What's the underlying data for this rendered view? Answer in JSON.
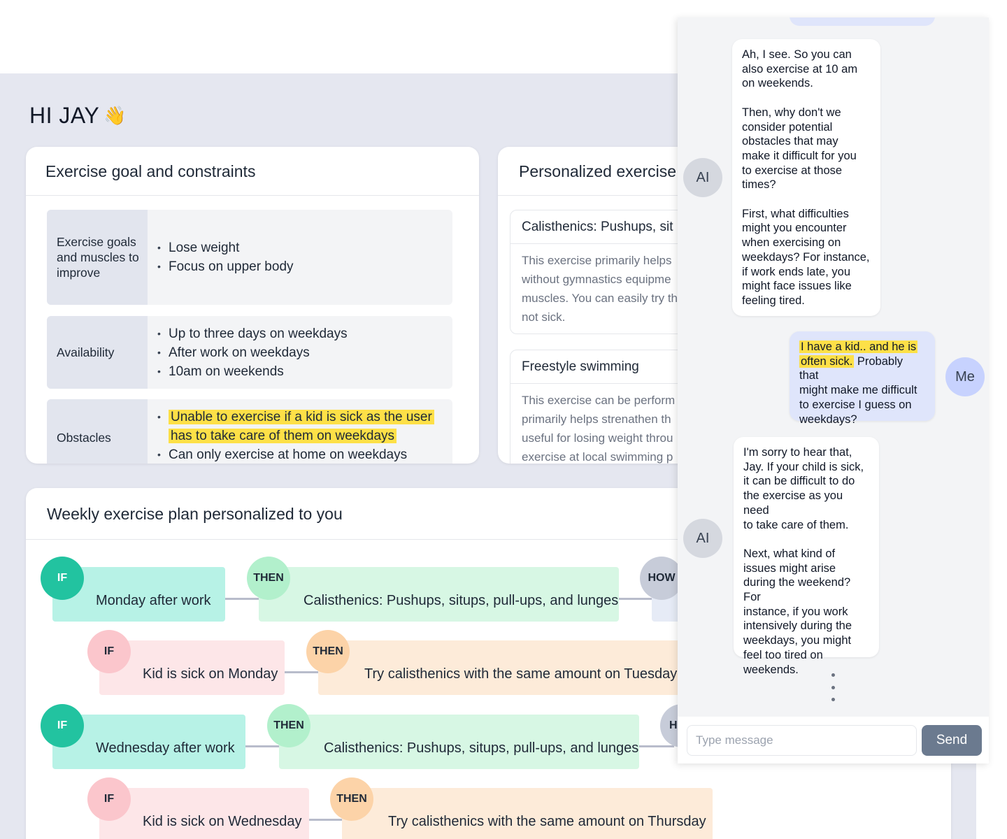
{
  "greeting": {
    "text": "HI JAY",
    "emoji": "👋"
  },
  "goal_card": {
    "title": "Exercise goal and constraints",
    "rows": [
      {
        "label": "Exercise goals and muscles to improve",
        "items": [
          "Lose weight",
          "Focus on upper body"
        ]
      },
      {
        "label": "Availability",
        "items": [
          "Up to three days on weekdays",
          "After work on weekdays",
          "10am on weekends"
        ]
      },
      {
        "label": "Obstacles",
        "highlighted_item": "Unable to exercise if a kid is sick as the user has to take care of them on weekdays",
        "items": [
          "Can only exercise at home on weekdays"
        ]
      }
    ]
  },
  "exercise_card": {
    "title": "Personalized exercise",
    "items": [
      {
        "title": "Calisthenics: Pushups, sit",
        "desc": [
          "This exercise primarily helps",
          "without gymnastics equipme",
          "muscles. You can easily try th",
          "not sick."
        ]
      },
      {
        "title": "Freestyle swimming",
        "desc": [
          "This exercise can be perform",
          "primarily helps strenathen th",
          "useful for losing weight throu",
          "exercise at local swimming p"
        ]
      }
    ]
  },
  "plan_card": {
    "title": "Weekly exercise plan personalized to you",
    "badges": {
      "if": "IF",
      "then": "THEN",
      "how": "HOW",
      "how_cut": "H"
    },
    "rows": [
      {
        "if": "Monday after work",
        "then": "Calisthenics: Pushups, situps, pull-ups, and lunges"
      },
      {
        "if": "Kid is sick on Monday",
        "then": "Try calisthenics with the same amount on Tuesday"
      },
      {
        "if": "Wednesday after work",
        "then": "Calisthenics: Pushups, situps, pull-ups, and lunges"
      },
      {
        "if": "Kid is sick on Wednesday",
        "then": "Try calisthenics with the same amount on Thursday"
      }
    ]
  },
  "chat": {
    "avatars": {
      "ai": "AI",
      "me": "Me"
    },
    "messages": [
      {
        "sender": "ai",
        "text": "Ah, I see. So you can\nalso exercise at 10 am\non weekends.\n\nThen, why don't we\nconsider potential\nobstacles that may\nmake it difficult for you\nto exercise at those\ntimes?\n\nFirst, what difficulties\nmight you encounter\nwhen exercising on\nweekdays? For instance,\nif work ends late, you\nmight face issues like\nfeeling tired."
      },
      {
        "sender": "me",
        "highlight_a": "I have a kid.. and he is",
        "highlight_b": "often sick.",
        "rest": " Probably that\nmight make me difficult\nto exercise I guess on\nweekdays?"
      },
      {
        "sender": "ai",
        "text": "I'm sorry to hear that,\nJay. If your child is sick,\nit can be difficult to do\nthe exercise as you need\nto take care of them.\n\nNext, what kind of\nissues might arise\nduring the weekend? For\ninstance, if you work\nintensively during the\nweekdays, you might\nfeel too tired on\nweekends."
      }
    ],
    "input_placeholder": "Type message",
    "send_label": "Send"
  },
  "colors": {
    "dashboard_bg": "#e5e7f0",
    "highlight": "#fde047",
    "if_badge_main": "#22c3a0",
    "if_pill_main": "#b7f2e6",
    "then_pill_main": "#d7f7e4",
    "if_pill_alt": "#fde6e8",
    "then_pill_alt": "#fdebd9",
    "send_button": "#6b7a8f",
    "me_bubble": "#dfe5fb"
  }
}
